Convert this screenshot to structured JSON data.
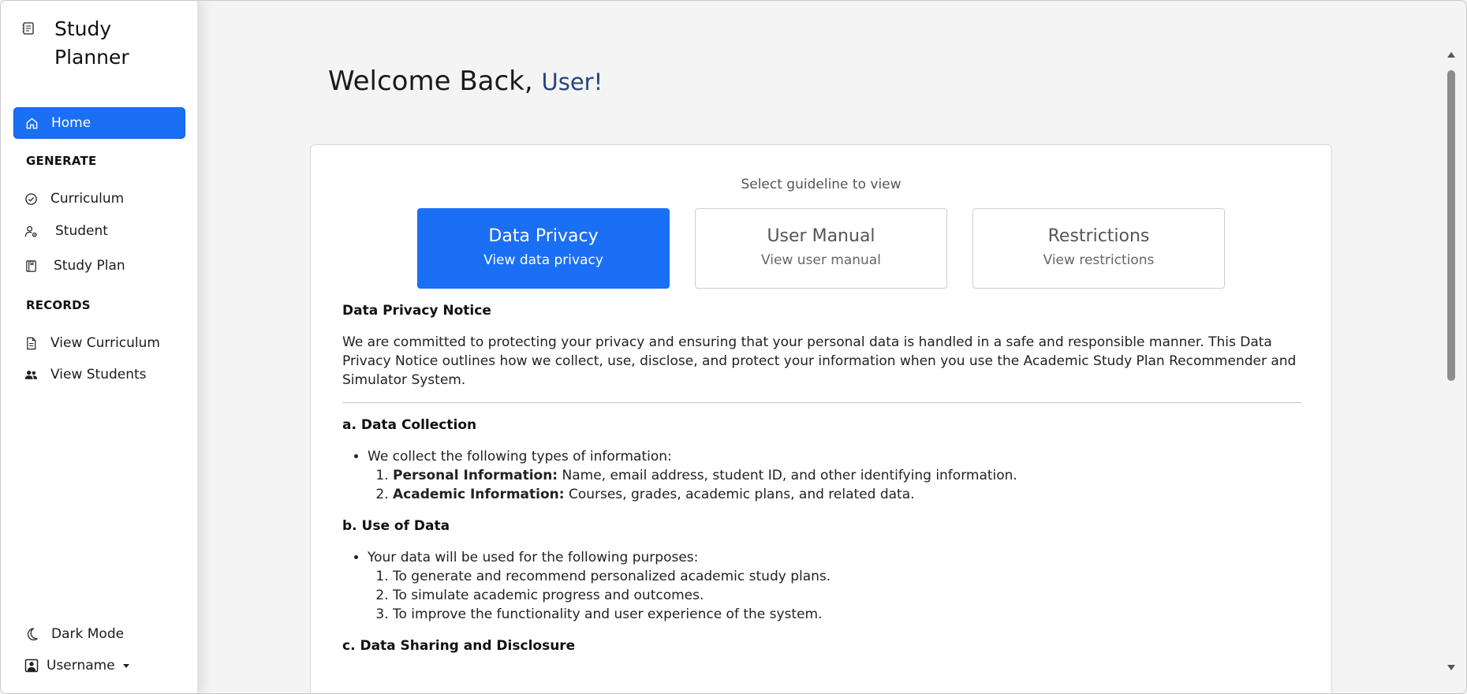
{
  "brand": {
    "title": "Study Planner",
    "icon": "notebook-icon"
  },
  "sidebar": {
    "home": {
      "label": "Home",
      "icon": "home-icon"
    },
    "generate_heading": "GENERATE",
    "generate_items": [
      {
        "label": "Curriculum",
        "icon": "check-circle-icon"
      },
      {
        "label": "Student",
        "icon": "user-gear-icon"
      },
      {
        "label": "Study Plan",
        "icon": "book-icon"
      }
    ],
    "records_heading": "RECORDS",
    "records_items": [
      {
        "label": "View Curriculum",
        "icon": "document-icon"
      },
      {
        "label": "View Students",
        "icon": "users-icon"
      }
    ],
    "dark_mode": {
      "label": "Dark Mode",
      "icon": "moon-icon"
    },
    "user_menu": {
      "label": "Username",
      "icon": "user-square-icon"
    }
  },
  "header": {
    "welcome": "Welcome Back,",
    "user": "User!"
  },
  "guidelines": {
    "select_label": "Select guideline to view",
    "options": [
      {
        "title": "Data Privacy",
        "subtitle": "View data privacy",
        "active": true
      },
      {
        "title": "User Manual",
        "subtitle": "View user manual",
        "active": false
      },
      {
        "title": "Restrictions",
        "subtitle": "View restrictions",
        "active": false
      }
    ]
  },
  "notice": {
    "heading": "Data Privacy Notice",
    "intro": "We are committed to protecting your privacy and ensuring that your personal data is handled in a safe and responsible manner. This Data Privacy Notice outlines how we collect, use, disclose, and protect your information when you use the Academic Study Plan Recommender and Simulator System.",
    "a": {
      "title": "a. Data Collection",
      "bullet": "We collect the following types of information:",
      "items": [
        {
          "label": "Personal Information:",
          "text": " Name, email address, student ID, and other identifying information."
        },
        {
          "label": "Academic Information:",
          "text": " Courses, grades, academic plans, and related data."
        }
      ]
    },
    "b": {
      "title": "b. Use of Data",
      "bullet": "Your data will be used for the following purposes:",
      "items": [
        "To generate and recommend personalized academic study plans.",
        "To simulate academic progress and outcomes.",
        "To improve the functionality and user experience of the system."
      ]
    },
    "c": {
      "title": "c. Data Sharing and Disclosure"
    }
  },
  "colors": {
    "accent": "#1a6ff5",
    "user_name": "#23457c"
  }
}
